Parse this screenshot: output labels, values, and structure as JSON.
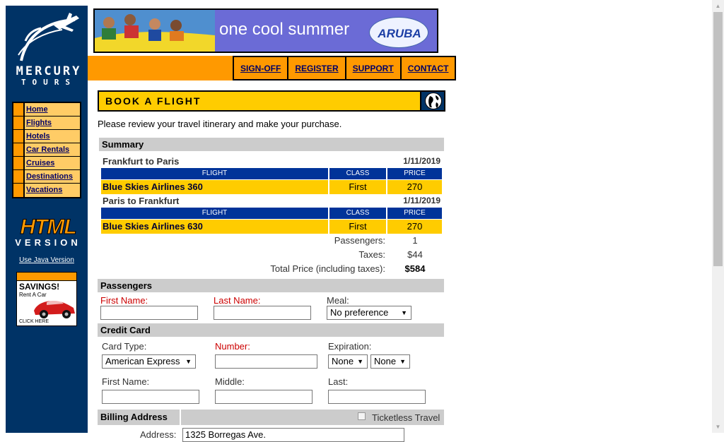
{
  "brand": {
    "line1": "MERCURY",
    "line2": "TOURS"
  },
  "sidebar": {
    "items": [
      {
        "label": "Home"
      },
      {
        "label": "Flights"
      },
      {
        "label": "Hotels"
      },
      {
        "label": "Car Rentals"
      },
      {
        "label": "Cruises"
      },
      {
        "label": "Destinations"
      },
      {
        "label": "Vacations"
      }
    ],
    "html_word": "HTML",
    "version_word": "VERSION",
    "java_link": "Use Java Version",
    "ad": {
      "headline": "SAVINGS!",
      "sub": "Rent A Car",
      "cta": "CLICK HERE"
    }
  },
  "banner": {
    "text": "one cool summer",
    "badge": "ARUBA"
  },
  "topnav": [
    {
      "label": "SIGN-OFF"
    },
    {
      "label": "REGISTER"
    },
    {
      "label": "SUPPORT"
    },
    {
      "label": "CONTACT"
    }
  ],
  "page": {
    "title": "BOOK A FLIGHT",
    "intro": "Please review your travel itinerary and make your purchase."
  },
  "summary": {
    "title": "Summary",
    "col_flight": "FLIGHT",
    "col_class": "CLASS",
    "col_price": "PRICE",
    "legs": [
      {
        "route": "Frankfurt to Paris",
        "date": "1/11/2019",
        "flight": "Blue Skies Airlines 360",
        "class": "First",
        "price": "270"
      },
      {
        "route": "Paris to Frankfurt",
        "date": "1/11/2019",
        "flight": "Blue Skies Airlines 630",
        "class": "First",
        "price": "270"
      }
    ],
    "passengers_label": "Passengers:",
    "passengers_value": "1",
    "taxes_label": "Taxes:",
    "taxes_value": "$44",
    "total_label": "Total Price (including taxes):",
    "total_value": "$584"
  },
  "passengers": {
    "title": "Passengers",
    "first_name_label": "First Name:",
    "last_name_label": "Last Name:",
    "meal_label": "Meal:",
    "meal_value": "No preference"
  },
  "credit_card": {
    "title": "Credit Card",
    "card_type_label": "Card Type:",
    "card_type_value": "American Express",
    "number_label": "Number:",
    "expiration_label": "Expiration:",
    "exp_month": "None",
    "exp_year": "None",
    "first_name_label": "First Name:",
    "middle_label": "Middle:",
    "last_label": "Last:"
  },
  "billing": {
    "title": "Billing Address",
    "ticketless_label": "Ticketless Travel",
    "address_label": "Address:",
    "address_value": "1325 Borregas Ave."
  }
}
